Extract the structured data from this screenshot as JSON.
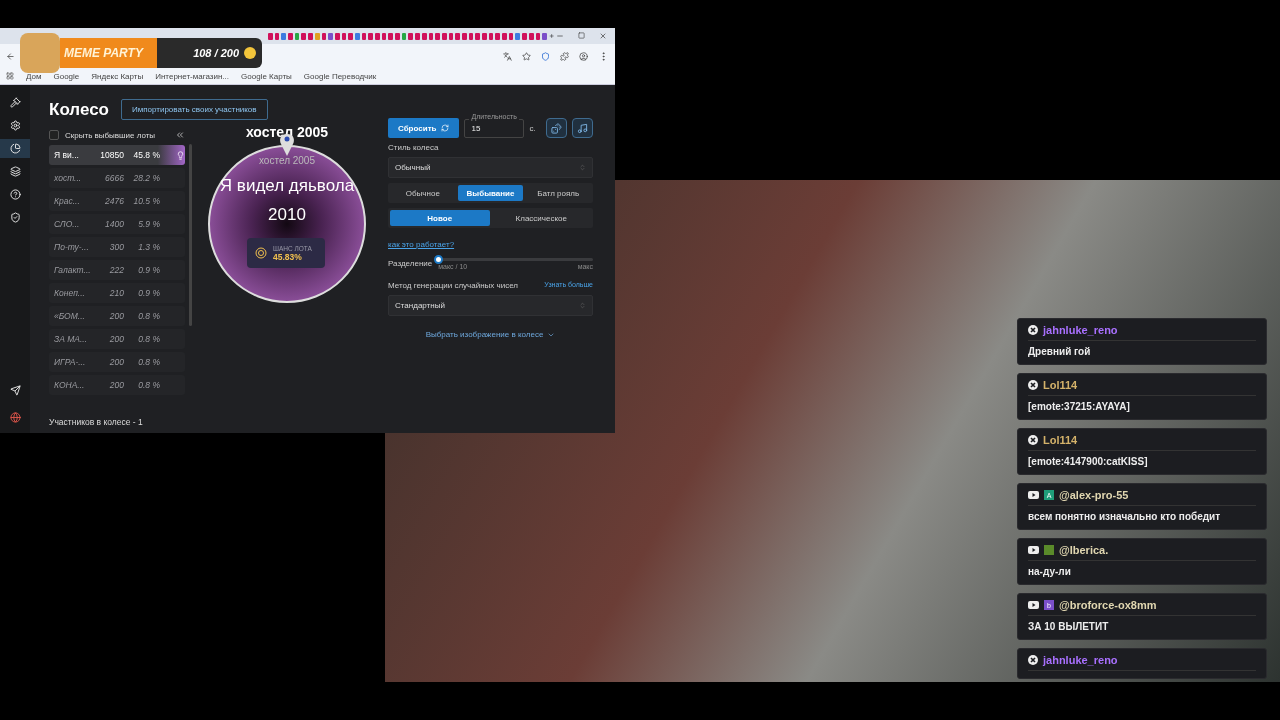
{
  "widget": {
    "title": "MEME PARTY",
    "count": "108 / 200"
  },
  "bookmarks": [
    "Дом",
    "Google",
    "Яндекс Карты",
    "Интернет-магазин...",
    "Google Карты",
    "Google Переводчик"
  ],
  "sidebar": {
    "items": [
      {
        "kind": "gavel",
        "selected": false
      },
      {
        "kind": "gear",
        "selected": false
      },
      {
        "kind": "pie",
        "selected": true
      },
      {
        "kind": "layers",
        "selected": false
      },
      {
        "kind": "help",
        "selected": false
      },
      {
        "kind": "shield",
        "selected": false
      }
    ]
  },
  "page": {
    "title": "Колесо",
    "import_button": "Импортировать своих участников"
  },
  "lots": {
    "hide_eliminated": {
      "label": "Скрыть выбывшие лоты",
      "checked": false
    },
    "rows": [
      {
        "name": "Я ви...",
        "amount": "10850",
        "percent": "45.8 %",
        "eliminated": false,
        "selected": true
      },
      {
        "name": "хост...",
        "amount": "6666",
        "percent": "28.2 %",
        "eliminated": true,
        "selected": false
      },
      {
        "name": "Крас...",
        "amount": "2476",
        "percent": "10.5 %",
        "eliminated": true,
        "selected": false
      },
      {
        "name": "СЛО...",
        "amount": "1400",
        "percent": "5.9 %",
        "eliminated": true,
        "selected": false
      },
      {
        "name": "По-ту-...",
        "amount": "300",
        "percent": "1.3 %",
        "eliminated": true,
        "selected": false
      },
      {
        "name": "Галакт...",
        "amount": "222",
        "percent": "0.9 %",
        "eliminated": true,
        "selected": false
      },
      {
        "name": "Конеп...",
        "amount": "210",
        "percent": "0.9 %",
        "eliminated": true,
        "selected": false
      },
      {
        "name": "«БОМ...",
        "amount": "200",
        "percent": "0.8 %",
        "eliminated": true,
        "selected": false
      },
      {
        "name": "ЗА МА...",
        "amount": "200",
        "percent": "0.8 %",
        "eliminated": true,
        "selected": false
      },
      {
        "name": "ИГРА-...",
        "amount": "200",
        "percent": "0.8 %",
        "eliminated": true,
        "selected": false
      },
      {
        "name": "КОНА...",
        "amount": "200",
        "percent": "0.8 %",
        "eliminated": true,
        "selected": false
      }
    ],
    "footer": "Участников в колесе - 1"
  },
  "wheel": {
    "title": "хостел 2005",
    "pointer_label": "хостел 2005",
    "current_lot": "Я видел дяьвола",
    "current_lot_year": "2010",
    "chance_label": "ШАНС ЛОТА",
    "chance": "45.83%"
  },
  "settings": {
    "reset_button": "Сбросить",
    "duration": {
      "label": "Длительность",
      "value": "15",
      "unit": "с."
    },
    "style": {
      "label": "Стиль колеса",
      "value": "Обычный"
    },
    "modes": [
      {
        "label": "Обычное",
        "selected": false
      },
      {
        "label": "Выбывание",
        "selected": true
      },
      {
        "label": "Батл рояль",
        "selected": false
      }
    ],
    "variants": [
      {
        "label": "Новое",
        "selected": true
      },
      {
        "label": "Классическое",
        "selected": false
      }
    ],
    "help_link": "как это работает?",
    "split": {
      "label": "Разделение",
      "level": 0,
      "min_label": "макс / 10",
      "max_label": "макс"
    },
    "rng": {
      "label": "Метод генерации случайных чисел",
      "link": "Узнать больше",
      "value": "Стандартный"
    },
    "image_toggle": "Выбрать изображение в колесе"
  },
  "chat": [
    {
      "kind": "kick",
      "user": "jahnluke_reno",
      "color": "#a970ff",
      "text": "Древний гой"
    },
    {
      "kind": "kick",
      "user": "Lol114",
      "color": "#d4b26a",
      "text": "[emote:37215:AYAYA]"
    },
    {
      "kind": "kick",
      "user": "Lol114",
      "color": "#d4b26a",
      "text": "[emote:4147900:catKISS]"
    },
    {
      "kind": "youtube",
      "user": "@alex-pro-55",
      "color": "#e0d6b0",
      "avatar": {
        "letter": "A",
        "color": "#1f9e7a"
      },
      "text": "всем понятно изначально кто победит"
    },
    {
      "kind": "youtube",
      "user": "@Iberica.",
      "color": "#e0d6b0",
      "avatar": {
        "color": "#5a8a2a"
      },
      "text": "на-ду-ли"
    },
    {
      "kind": "youtube",
      "user": "@broforce-ox8mm",
      "color": "#e0d6b0",
      "avatar": {
        "letter": "b",
        "color": "#7b4fc9"
      },
      "text": "ЗА 10 ВЫЛЕТИТ"
    },
    {
      "kind": "kick",
      "user": "jahnluke_reno",
      "color": "#a970ff"
    }
  ]
}
